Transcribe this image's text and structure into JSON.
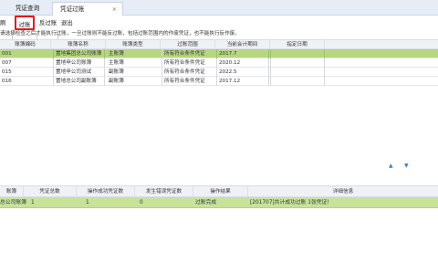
{
  "tabs": {
    "tab1_label": "凭证查询",
    "tab2_label": "凭证过账",
    "tab2_close": "×"
  },
  "toolbar": {
    "left_partial": "刷",
    "filter_label": "过账",
    "unfilter_label": "反过账",
    "exit_label": "退出"
  },
  "hint": "请选择检查之后才能执行过账，一旦过账则不能反过账，包括过账范围内的作废凭证，也不能执行反作废。",
  "top_table": {
    "headers": [
      "账簿编码",
      "账簿名称",
      "账簿类型",
      "过账范围",
      "当前会计期间",
      "指定日期"
    ],
    "rows": [
      {
        "code": "001",
        "name": "置地集团总公司账簿",
        "type": "主账簿",
        "scope": "所有符合条件凭证",
        "period": "2017.7",
        "date": ""
      },
      {
        "code": "007",
        "name": "置地甲公司账簿",
        "type": "主账簿",
        "scope": "所有符合条件凭证",
        "period": "2020.12",
        "date": ""
      },
      {
        "code": "015",
        "name": "置地甲公司测试",
        "type": "副账簿",
        "scope": "所有符合条件凭证",
        "period": "2022.5",
        "date": ""
      },
      {
        "code": "016",
        "name": "置地总公司副账簿",
        "type": "副账簿",
        "scope": "所有符合条件凭证",
        "period": "2017.12",
        "date": ""
      }
    ]
  },
  "arrows": {
    "up": "▲",
    "down": "▼"
  },
  "bottom_table": {
    "headers": [
      "账簿",
      "凭证总数",
      "操作成功凭证数",
      "发生错误凭证数",
      "操作结果",
      "详细信息"
    ],
    "row": {
      "book": "总公司账簿",
      "total": "1",
      "success": "1",
      "errors": "0",
      "result": "过账完成",
      "detail": "[201707]共计成功过账 1张凭证!"
    }
  }
}
